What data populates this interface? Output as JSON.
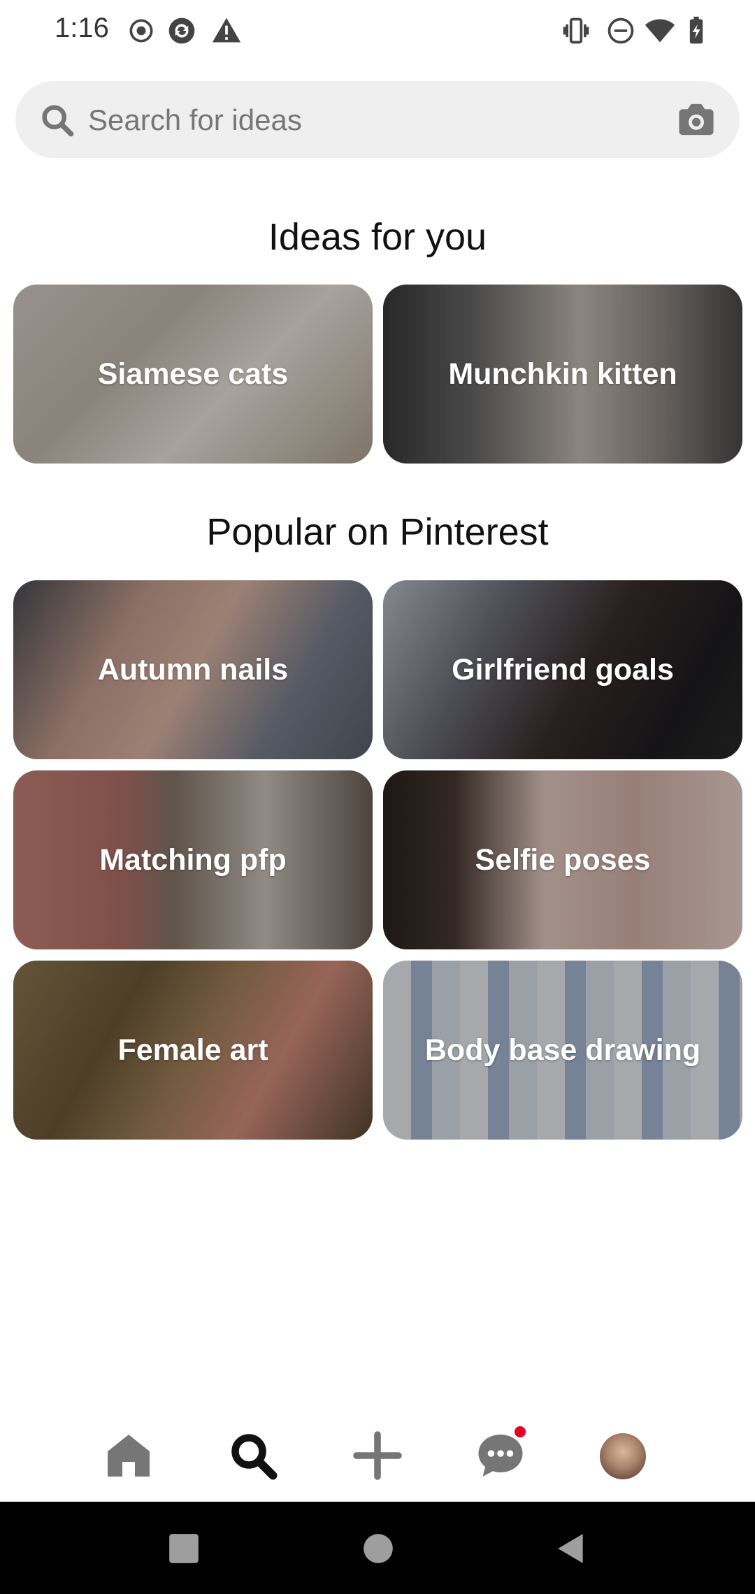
{
  "status_bar": {
    "time": "1:16",
    "left_icons": [
      "record-icon",
      "sync-icon",
      "warning-icon"
    ],
    "right_icons": [
      "vibrate-icon",
      "dnd-icon",
      "wifi-icon",
      "battery-charging-icon"
    ]
  },
  "search": {
    "placeholder": "Search for ideas",
    "icons": [
      "search-icon",
      "camera-icon"
    ]
  },
  "ideas_section": {
    "title": "Ideas for you",
    "cards": [
      {
        "label": "Siamese cats"
      },
      {
        "label": "Munchkin kitten"
      }
    ]
  },
  "popular_section": {
    "title": "Popular on Pinterest",
    "cards": [
      {
        "label": "Autumn nails"
      },
      {
        "label": "Girlfriend goals"
      },
      {
        "label": "Matching pfp"
      },
      {
        "label": "Selfie poses"
      },
      {
        "label": "Female art"
      },
      {
        "label": "Body base drawing"
      }
    ]
  },
  "bottom_nav": {
    "items": [
      "home-icon",
      "search-icon",
      "add-icon",
      "messages-icon",
      "profile-avatar"
    ],
    "active": "search-icon",
    "notification_color": "#e60023"
  },
  "system_nav": [
    "recents-button",
    "home-button",
    "back-button"
  ],
  "colors": {
    "search_bg": "#efefef",
    "accent": "#e60023",
    "text": "#111111"
  }
}
